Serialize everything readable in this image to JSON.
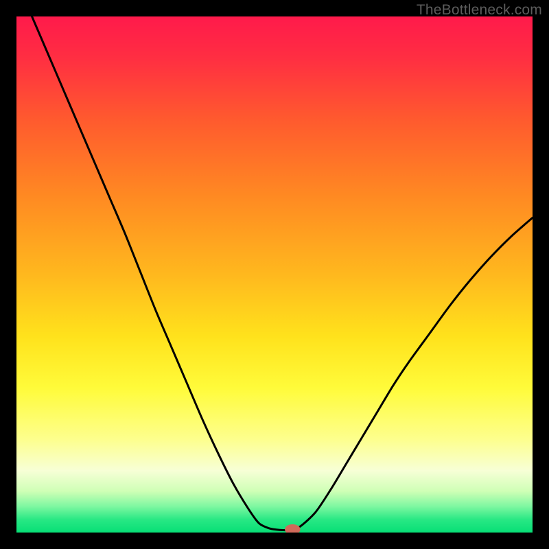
{
  "watermark": "TheBottleneck.com",
  "colors": {
    "gradient_stops": [
      {
        "offset": 0.0,
        "color": "#ff1a4b"
      },
      {
        "offset": 0.08,
        "color": "#ff2e42"
      },
      {
        "offset": 0.2,
        "color": "#ff5a2e"
      },
      {
        "offset": 0.35,
        "color": "#ff8a22"
      },
      {
        "offset": 0.5,
        "color": "#ffb81e"
      },
      {
        "offset": 0.62,
        "color": "#ffe21c"
      },
      {
        "offset": 0.72,
        "color": "#fffb3a"
      },
      {
        "offset": 0.82,
        "color": "#fdff8e"
      },
      {
        "offset": 0.88,
        "color": "#f7ffd6"
      },
      {
        "offset": 0.92,
        "color": "#cfffb6"
      },
      {
        "offset": 0.95,
        "color": "#7cf7a0"
      },
      {
        "offset": 0.975,
        "color": "#28e884"
      },
      {
        "offset": 1.0,
        "color": "#07df76"
      }
    ],
    "curve": "#000000",
    "marker_fill": "#d06a5a",
    "marker_stroke": "#b85a4a",
    "background": "#000000"
  },
  "chart_data": {
    "type": "line",
    "title": "",
    "xlabel": "",
    "ylabel": "",
    "xlim": [
      0,
      100
    ],
    "ylim": [
      0,
      100
    ],
    "grid": false,
    "description": "Bottleneck curve: V-shaped line. High on the left, drops steeply to a minimum, then rises to the right. Background is a vertical gradient red→green indicating bottleneck severity.",
    "curve_points": [
      {
        "x": 3,
        "y": 100
      },
      {
        "x": 6,
        "y": 93
      },
      {
        "x": 9,
        "y": 86
      },
      {
        "x": 12,
        "y": 79
      },
      {
        "x": 15,
        "y": 72
      },
      {
        "x": 18,
        "y": 65
      },
      {
        "x": 21,
        "y": 58
      },
      {
        "x": 24,
        "y": 50.5
      },
      {
        "x": 27,
        "y": 43
      },
      {
        "x": 30,
        "y": 36
      },
      {
        "x": 33,
        "y": 29
      },
      {
        "x": 36,
        "y": 22
      },
      {
        "x": 39,
        "y": 15.5
      },
      {
        "x": 42,
        "y": 9.5
      },
      {
        "x": 45,
        "y": 4.5
      },
      {
        "x": 47,
        "y": 1.8
      },
      {
        "x": 49,
        "y": 0.8
      },
      {
        "x": 51,
        "y": 0.5
      },
      {
        "x": 53,
        "y": 0.5
      },
      {
        "x": 55,
        "y": 1.2
      },
      {
        "x": 58,
        "y": 4.0
      },
      {
        "x": 61,
        "y": 8.5
      },
      {
        "x": 64,
        "y": 13.5
      },
      {
        "x": 67,
        "y": 18.5
      },
      {
        "x": 70,
        "y": 23.5
      },
      {
        "x": 73,
        "y": 28.5
      },
      {
        "x": 76,
        "y": 33.0
      },
      {
        "x": 80,
        "y": 38.5
      },
      {
        "x": 84,
        "y": 44.0
      },
      {
        "x": 88,
        "y": 49.0
      },
      {
        "x": 92,
        "y": 53.5
      },
      {
        "x": 96,
        "y": 57.5
      },
      {
        "x": 100,
        "y": 61.0
      }
    ],
    "marker": {
      "x": 53.5,
      "y": 0.6,
      "rx": 1.5,
      "ry": 1.0
    }
  }
}
